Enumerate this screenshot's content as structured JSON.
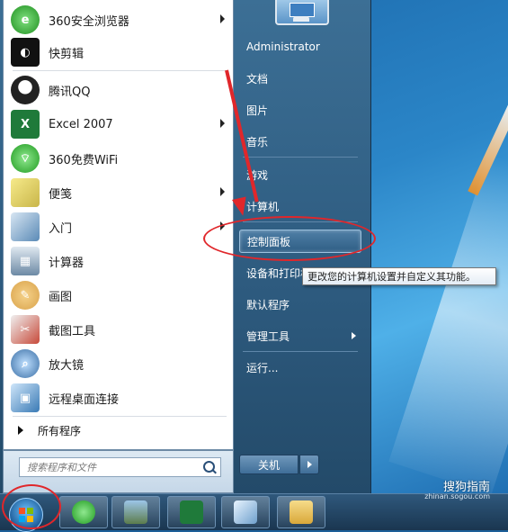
{
  "start_menu": {
    "programs": [
      {
        "label": "360安全浏览器",
        "icon": "360-browser-icon",
        "has_submenu": true,
        "color": "#2aa52a"
      },
      {
        "label": "快剪辑",
        "icon": "kuaijianji-icon",
        "has_submenu": false,
        "color": "#111111"
      },
      {
        "label": "腾讯QQ",
        "icon": "qq-penguin-icon",
        "has_submenu": false,
        "color": "#1a1a1a"
      },
      {
        "label": "Excel 2007",
        "icon": "excel-icon",
        "has_submenu": true,
        "color": "#1f7a3a"
      },
      {
        "label": "360免费WiFi",
        "icon": "wifi-icon",
        "has_submenu": false,
        "color": "#2a9a2a"
      },
      {
        "label": "便笺",
        "icon": "sticky-notes-icon",
        "has_submenu": true,
        "color": "#c9b64a"
      },
      {
        "label": "入门",
        "icon": "getting-started-icon",
        "has_submenu": true,
        "color": "#5a8ab6"
      },
      {
        "label": "计算器",
        "icon": "calculator-icon",
        "has_submenu": false,
        "color": "#6d8aa5"
      },
      {
        "label": "画图",
        "icon": "paint-icon",
        "has_submenu": false,
        "color": "#d9a24a"
      },
      {
        "label": "截图工具",
        "icon": "snipping-tool-icon",
        "has_submenu": false,
        "color": "#c74a3a"
      },
      {
        "label": "放大镜",
        "icon": "magnifier-icon",
        "has_submenu": false,
        "color": "#3a6ea5"
      },
      {
        "label": "远程桌面连接",
        "icon": "remote-desktop-icon",
        "has_submenu": false,
        "color": "#3a7ab5"
      }
    ],
    "all_programs": "所有程序",
    "search_placeholder": "搜索程序和文件"
  },
  "right_panel": {
    "items": [
      {
        "label": "Administrator",
        "has_submenu": false
      },
      {
        "label": "文档",
        "has_submenu": false
      },
      {
        "label": "图片",
        "has_submenu": false
      },
      {
        "label": "音乐",
        "has_submenu": false
      },
      {
        "label": "游戏",
        "has_submenu": false
      },
      {
        "label": "计算机",
        "has_submenu": false
      },
      {
        "label": "控制面板",
        "has_submenu": false,
        "highlighted": true
      },
      {
        "label": "设备和打印机",
        "has_submenu": false
      },
      {
        "label": "默认程序",
        "has_submenu": false
      },
      {
        "label": "管理工具",
        "has_submenu": true
      },
      {
        "label": "运行...",
        "has_submenu": false
      }
    ],
    "shutdown_label": "关机"
  },
  "tooltip": "更改您的计算机设置并自定义其功能。",
  "watermark": {
    "main": "搜狗指南",
    "sub": "zhinan.sogou.com"
  },
  "colors": {
    "highlight_circle": "#e0272b",
    "menu_blue": "#2d5a7e"
  }
}
